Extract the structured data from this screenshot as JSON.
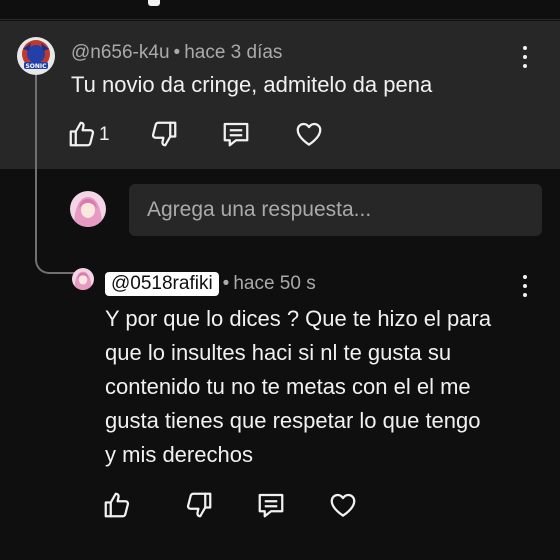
{
  "comment": {
    "author": "@n656-k4u",
    "separator": "•",
    "time": "hace 3 días",
    "text": "Tu novio da cringe, admitelo da pena",
    "like_count": "1",
    "actions": [
      "thumbs-up-icon",
      "thumbs-down-icon",
      "reply-icon",
      "heart-icon"
    ]
  },
  "reply_box": {
    "placeholder": "Agrega una respuesta..."
  },
  "reply": {
    "author": "@0518rafiki",
    "separator": "•",
    "time": "hace 50 s",
    "text_lines": [
      "Y por que lo dices ? Que te hizo el para",
      "que lo insultes haci si nl te gusta su",
      "contenido tu no te metas con el el me",
      "gusta tienes que respetar lo que tengo",
      "y mis derechos"
    ],
    "actions": [
      "thumbs-up-icon",
      "thumbs-down-icon",
      "reply-icon",
      "heart-icon"
    ]
  },
  "colors": {
    "background": "#0f0f0f",
    "card": "#272727",
    "secondary_text": "#aaaaaa",
    "primary_text": "#f1f1f1"
  }
}
